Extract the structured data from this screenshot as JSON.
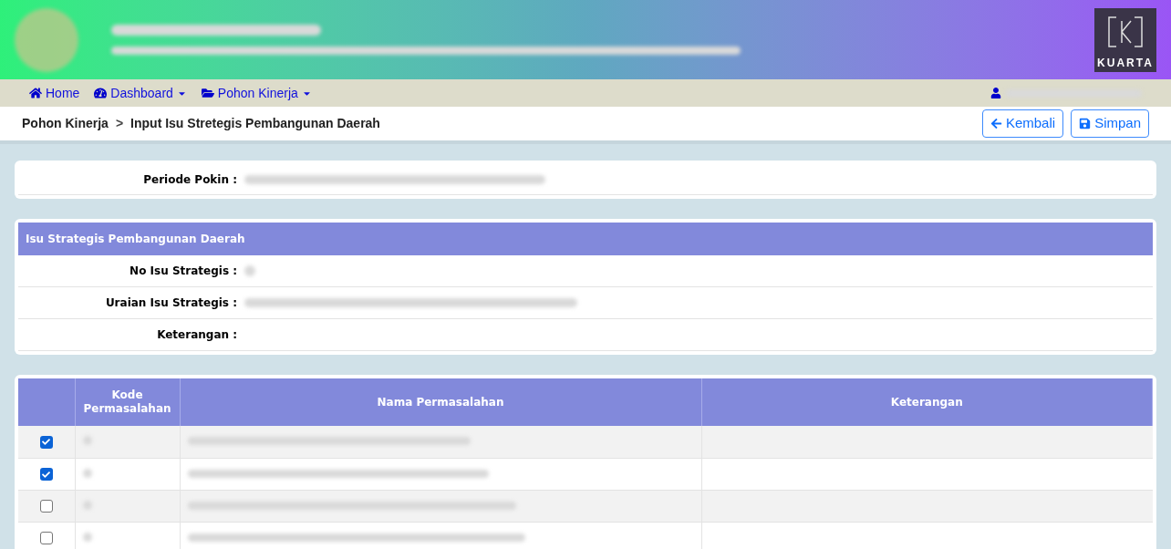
{
  "header": {
    "logo_text": "KUARTA"
  },
  "nav": {
    "items": [
      {
        "kind": "home",
        "label": "Home",
        "dropdown": false
      },
      {
        "kind": "dashboard",
        "label": "Dashboard",
        "dropdown": true
      },
      {
        "kind": "folder",
        "label": "Pohon Kinerja",
        "dropdown": true
      }
    ]
  },
  "breadcrumb": {
    "parent": "Pohon Kinerja",
    "separator": ">",
    "current": "Input Isu Stretegis Pembangunan Daerah"
  },
  "actions": [
    {
      "kind": "back",
      "label": "Kembali"
    },
    {
      "kind": "save",
      "label": "Simpan"
    }
  ],
  "periode": {
    "label": "Periode Pokin :"
  },
  "isu": {
    "title": "Isu Strategis Pembangunan Daerah",
    "fields": [
      {
        "label": "No Isu Strategis :",
        "kind": "blurshort"
      },
      {
        "label": "Uraian Isu Strategis :",
        "kind": "blurlong"
      },
      {
        "label": "Keterangan :",
        "kind": "empty"
      }
    ]
  },
  "table": {
    "columns": [
      "Kode Permasalahan",
      "Nama Permasalahan",
      "Keterangan"
    ],
    "rows": [
      {
        "checked": true
      },
      {
        "checked": true
      },
      {
        "checked": false
      },
      {
        "checked": false
      }
    ]
  }
}
